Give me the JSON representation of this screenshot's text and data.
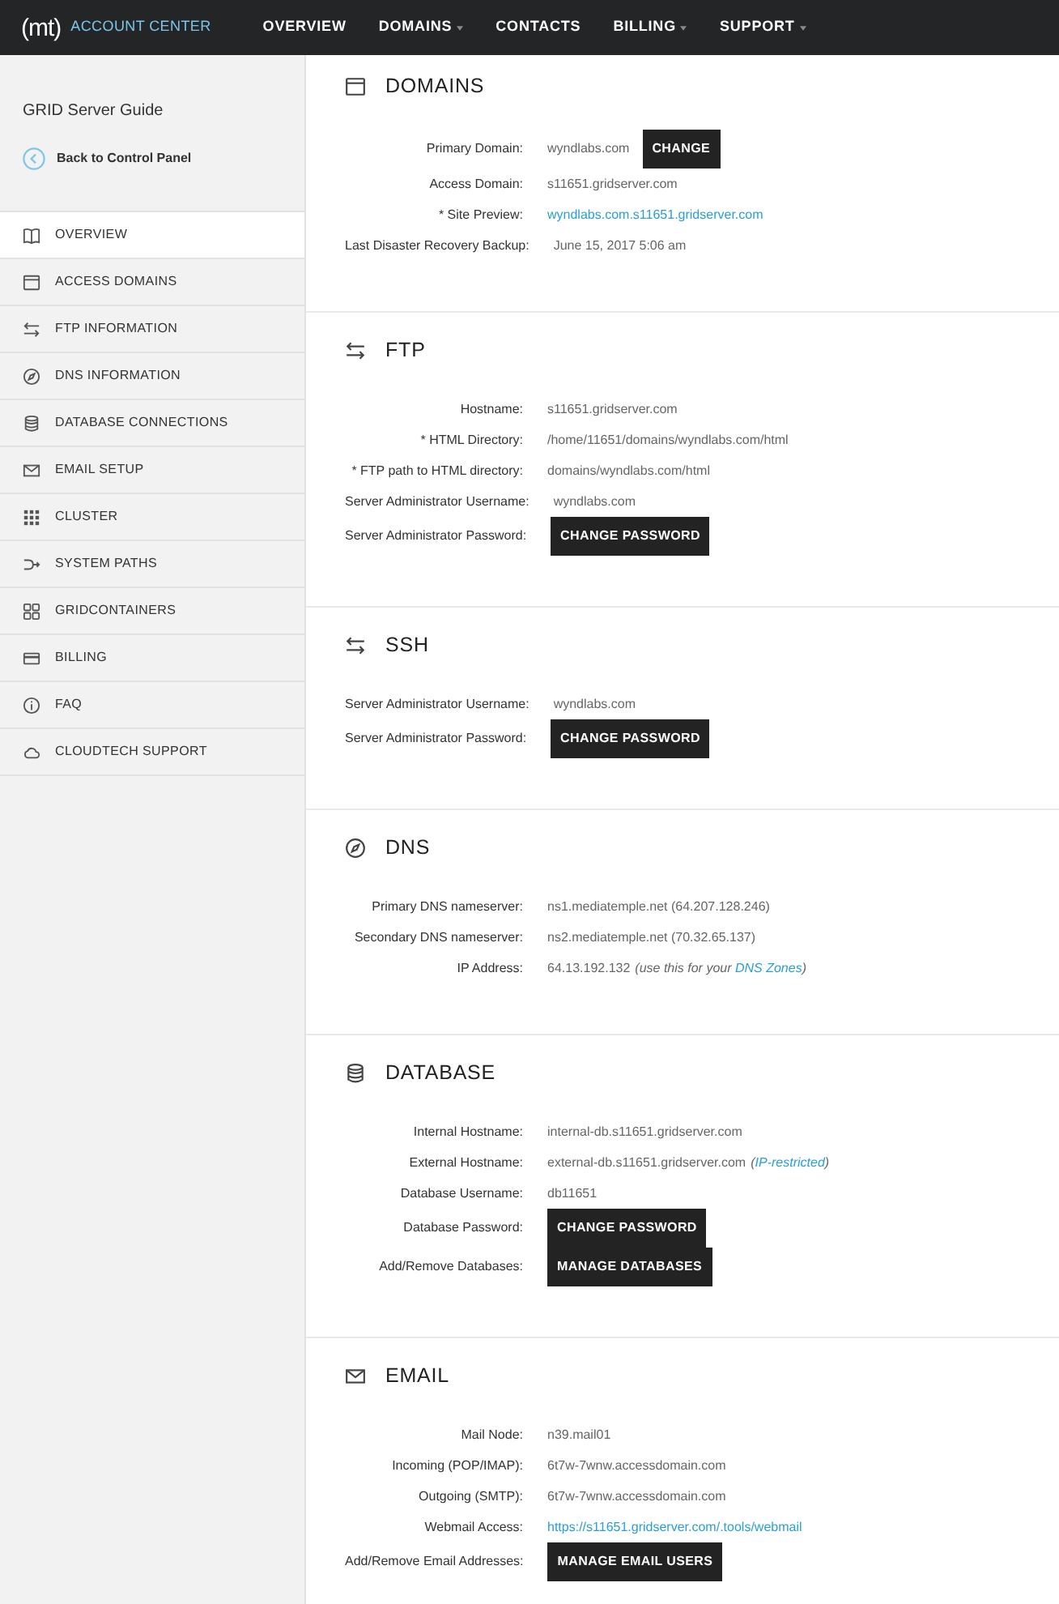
{
  "top_nav": {
    "logo": "(mt)",
    "product": "ACCOUNT CENTER",
    "items": [
      {
        "label": "OVERVIEW",
        "dropdown": false
      },
      {
        "label": "DOMAINS",
        "dropdown": true
      },
      {
        "label": "CONTACTS",
        "dropdown": false
      },
      {
        "label": "BILLING",
        "dropdown": true
      },
      {
        "label": "SUPPORT",
        "dropdown": true
      }
    ]
  },
  "sidebar": {
    "title": "GRID Server Guide",
    "back_link": "Back to Control Panel",
    "items": [
      {
        "label": "OVERVIEW",
        "selected": true
      },
      {
        "label": "ACCESS DOMAINS",
        "selected": false
      },
      {
        "label": "FTP INFORMATION",
        "selected": false
      },
      {
        "label": "DNS INFORMATION",
        "selected": false
      },
      {
        "label": "DATABASE CONNECTIONS",
        "selected": false
      },
      {
        "label": "EMAIL SETUP",
        "selected": false
      },
      {
        "label": "CLUSTER",
        "selected": false
      },
      {
        "label": "SYSTEM PATHS",
        "selected": false
      },
      {
        "label": "GRIDCONTAINERS",
        "selected": false
      },
      {
        "label": "BILLING",
        "selected": false
      },
      {
        "label": "FAQ",
        "selected": false
      },
      {
        "label": "CLOUDTECH SUPPORT",
        "selected": false
      }
    ]
  },
  "sections": [
    {
      "title": "DOMAINS",
      "rows": [
        {
          "label": "Primary Domain:",
          "value": "wyndlabs.com",
          "button": "CHANGE"
        },
        {
          "label": "Access Domain:",
          "value": "s11651.gridserver.com"
        },
        {
          "label": "* Site Preview:",
          "link": "wyndlabs.com.s11651.gridserver.com"
        },
        {
          "label": "Last Disaster Recovery Backup:",
          "value": "June 15, 2017 5:06 am"
        }
      ]
    },
    {
      "title": "FTP",
      "rows": [
        {
          "label": "Hostname:",
          "value": "s11651.gridserver.com"
        },
        {
          "label": "* HTML Directory:",
          "value": "/home/11651/domains/wyndlabs.com/html"
        },
        {
          "label": "* FTP path to HTML directory:",
          "value": "domains/wyndlabs.com/html"
        },
        {
          "label": "Server Administrator Username:",
          "value": "wyndlabs.com"
        },
        {
          "label": "Server Administrator Password:",
          "button": "CHANGE PASSWORD"
        }
      ]
    },
    {
      "title": "SSH",
      "rows": [
        {
          "label": "Server Administrator Username:",
          "value": "wyndlabs.com"
        },
        {
          "label": "Server Administrator Password:",
          "button": "CHANGE PASSWORD"
        }
      ]
    },
    {
      "title": "DNS",
      "rows": [
        {
          "label": "Primary DNS nameserver:",
          "value": "ns1.mediatemple.net (64.207.128.246)"
        },
        {
          "label": "Secondary DNS nameserver:",
          "value": "ns2.mediatemple.net (70.32.65.137)"
        },
        {
          "label": "IP Address:",
          "value": "64.13.192.132",
          "note": {
            "before": "(use this for your ",
            "link": "DNS Zones",
            "after": ")"
          }
        }
      ]
    },
    {
      "title": "DATABASE",
      "rows": [
        {
          "label": "Internal Hostname:",
          "value": "internal-db.s11651.gridserver.com"
        },
        {
          "label": "External Hostname:",
          "value": "external-db.s11651.gridserver.com",
          "note": {
            "before": "(",
            "link": "IP-restricted",
            "after": ")"
          }
        },
        {
          "label": "Database Username:",
          "value": "db11651"
        },
        {
          "label": "Database Password:",
          "button": "CHANGE PASSWORD"
        },
        {
          "label": "Add/Remove Databases:",
          "button": "MANAGE DATABASES"
        }
      ]
    },
    {
      "title": "EMAIL",
      "rows": [
        {
          "label": "Mail Node:",
          "value": "n39.mail01"
        },
        {
          "label": "Incoming (POP/IMAP):",
          "value": "6t7w-7wnw.accessdomain.com"
        },
        {
          "label": "Outgoing (SMTP):",
          "value": "6t7w-7wnw.accessdomain.com"
        },
        {
          "label": "Webmail Access:",
          "link": "https://s11651.gridserver.com/.tools/webmail"
        },
        {
          "label": "Add/Remove Email Addresses:",
          "button": "MANAGE EMAIL USERS"
        }
      ]
    }
  ]
}
